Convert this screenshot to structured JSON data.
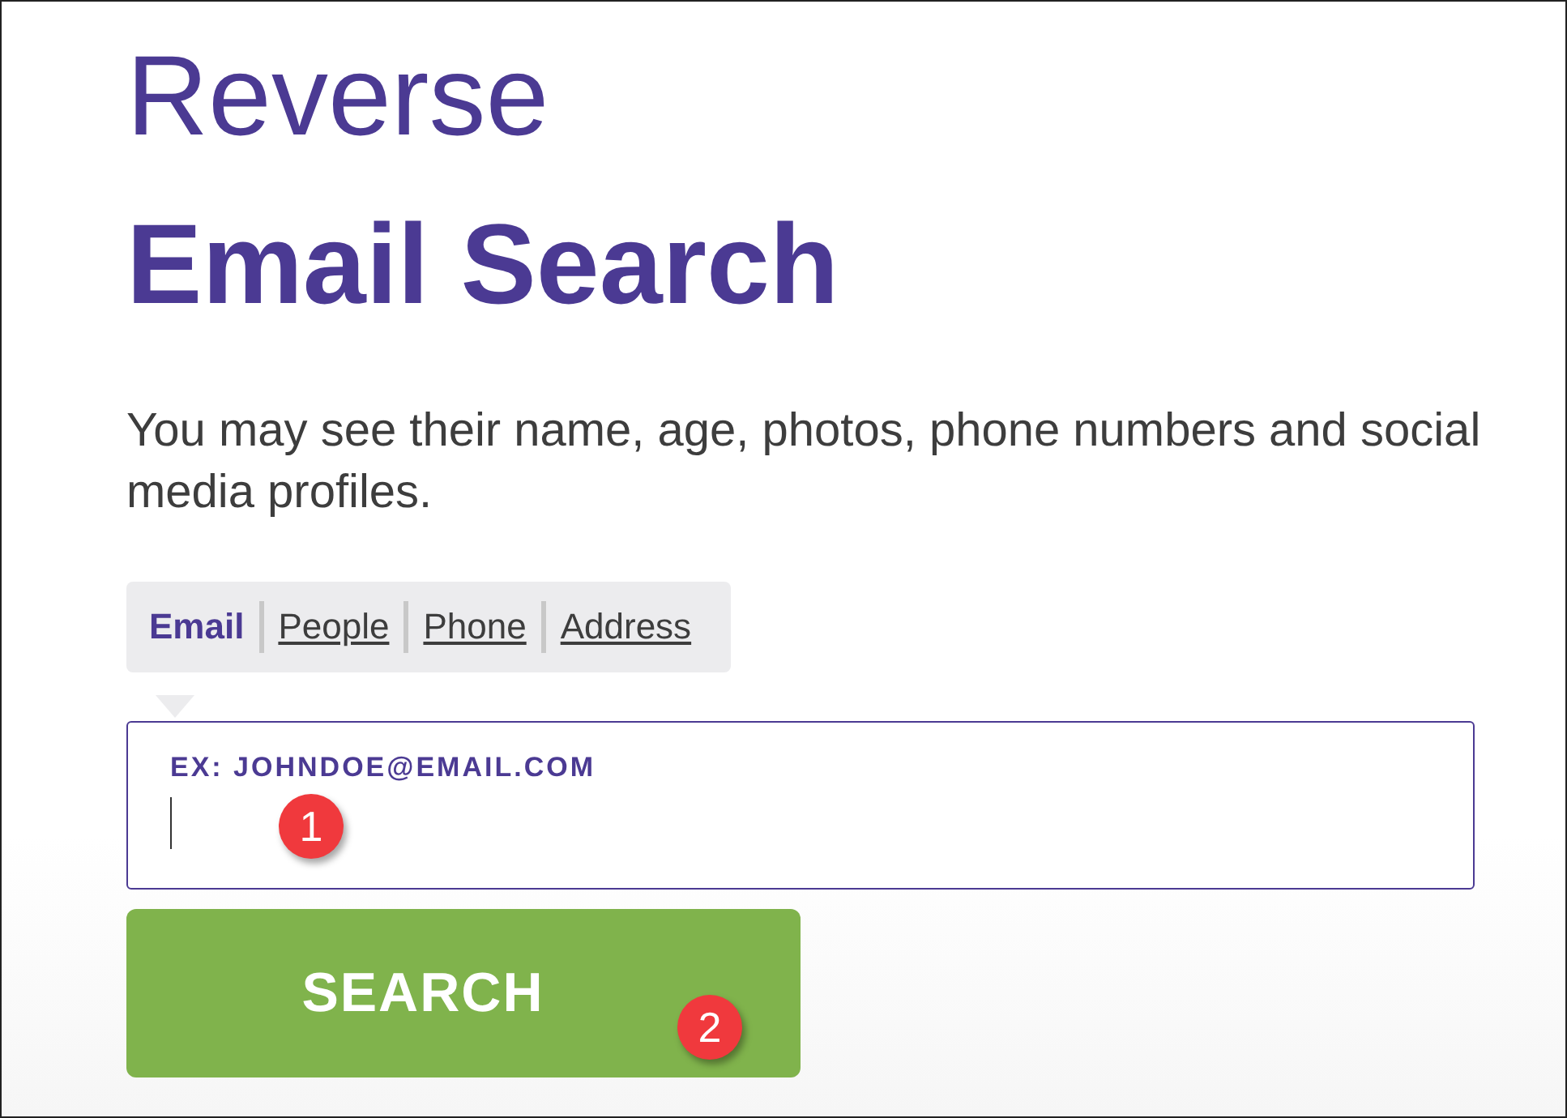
{
  "heading": {
    "line_1": "Reverse",
    "line_2": "Email Search"
  },
  "description": "You may see their name, age, photos, phone numbers and social media profiles.",
  "tabs": [
    {
      "label": "Email",
      "selected": true
    },
    {
      "label": "People",
      "selected": false
    },
    {
      "label": "Phone",
      "selected": false
    },
    {
      "label": "Address",
      "selected": false
    }
  ],
  "search_field": {
    "label": "EX: JOHNDOE@EMAIL.COM",
    "callout": "1"
  },
  "search_button": {
    "label": "SEARCH",
    "callout": "2"
  }
}
